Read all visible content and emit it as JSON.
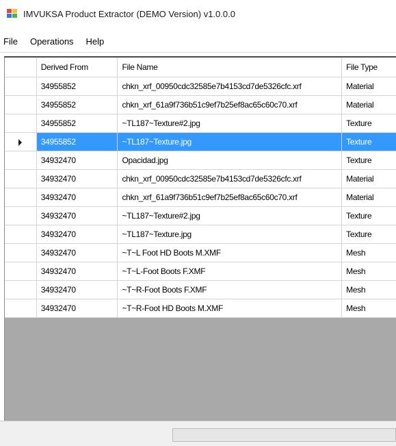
{
  "window": {
    "title": "IMVUKSA Product Extractor (DEMO Version) v1.0.0.0"
  },
  "menu": {
    "items": [
      "File",
      "Operations",
      "Help"
    ]
  },
  "grid": {
    "columns": [
      "Derived From",
      "File Name",
      "File Type"
    ],
    "selected_index": 3,
    "rows": [
      {
        "derived_from": "34955852",
        "file_name": "chkn_xrf_00950cdc32585e7b4153cd7de5326cfc.xrf",
        "file_type": "Material"
      },
      {
        "derived_from": "34955852",
        "file_name": "chkn_xrf_61a9f736b51c9ef7b25ef8ac65c60c70.xrf",
        "file_type": "Material"
      },
      {
        "derived_from": "34955852",
        "file_name": "~TL187~Texture#2.jpg",
        "file_type": "Texture"
      },
      {
        "derived_from": "34955852",
        "file_name": "~TL187~Texture.jpg",
        "file_type": "Texture"
      },
      {
        "derived_from": "34932470",
        "file_name": "Opacidad.jpg",
        "file_type": "Texture"
      },
      {
        "derived_from": "34932470",
        "file_name": "chkn_xrf_00950cdc32585e7b4153cd7de5326cfc.xrf",
        "file_type": "Material"
      },
      {
        "derived_from": "34932470",
        "file_name": "chkn_xrf_61a9f736b51c9ef7b25ef8ac65c60c70.xrf",
        "file_type": "Material"
      },
      {
        "derived_from": "34932470",
        "file_name": "~TL187~Texture#2.jpg",
        "file_type": "Texture"
      },
      {
        "derived_from": "34932470",
        "file_name": "~TL187~Texture.jpg",
        "file_type": "Texture"
      },
      {
        "derived_from": "34932470",
        "file_name": "~T~L Foot HD Boots M.XMF",
        "file_type": "Mesh"
      },
      {
        "derived_from": "34932470",
        "file_name": "~T~L-Foot Boots F.XMF",
        "file_type": "Mesh"
      },
      {
        "derived_from": "34932470",
        "file_name": "~T~R-Foot Boots F.XMF",
        "file_type": "Mesh"
      },
      {
        "derived_from": "34932470",
        "file_name": "~T~R-Foot HD Boots M.XMF",
        "file_type": "Mesh"
      }
    ]
  },
  "statusbar": {
    "progress": 0
  },
  "colors": {
    "selection": "#3399ff",
    "empty_area": "#a9a9a9"
  }
}
